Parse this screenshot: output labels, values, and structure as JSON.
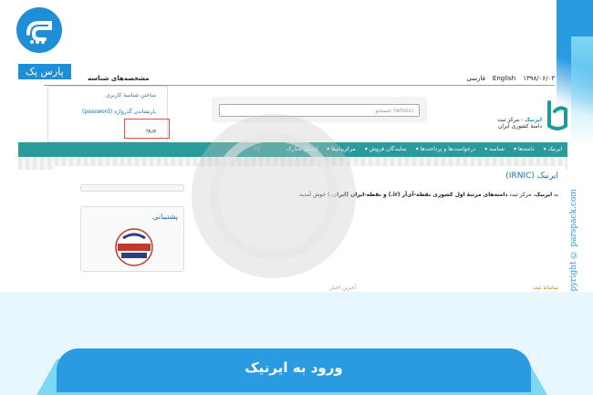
{
  "brand": {
    "tag": "پارس پک",
    "copyright": "copyright © parspack.com"
  },
  "topbar": {
    "date": "۱۳۹۸/۰۶/۰۳",
    "lang_en": "English",
    "lang_fa": "فارسی",
    "account_label": "مشخصه‌های شناسه"
  },
  "dropdown": {
    "items": [
      "ساختن شناسهٔ کاربری",
      "بازنشاندن گذرواژه (password)",
      "ورود"
    ]
  },
  "header": {
    "search_placeholder": "(whois) جستجو",
    "site_name": "ایرنیک",
    "site_sub1": "- مرکز ثبت",
    "site_sub2": "دامنهٔ کشوری ایران"
  },
  "navbar": {
    "items": [
      "ایرنیک ▾",
      "دامنه‌ها ▾",
      "شناسه ▾",
      "درخواست‌ها و پرداخت‌ها ▾",
      "نمایندگان فروش ▾",
      "مرکزپیام‌ها ▾",
      "ارسال مدارک"
    ]
  },
  "content": {
    "title": "ایرنیک (IRNIC)",
    "welcome_pre": "به",
    "welcome_name": "ایرنیک",
    "welcome_mid": "، مرکز ثبت",
    "welcome_bold": "دامنه‌های مرتبهٔ اول کشوری نقطه-آی‌آر (ir.) و نقطه-ایران (ایران.)",
    "welcome_post": "خوش آمدید.",
    "support_title": "پشتیبانی",
    "footer_link1": "سامانهٔ ثبت",
    "footer_link2": "آخرین اخبار"
  },
  "banner": {
    "text": "ورود به ایرنیک"
  },
  "colors": {
    "brand_blue": "#2a9be0",
    "teal_nav": "#2a9a9a",
    "light_cyan": "#7dd8f5"
  }
}
